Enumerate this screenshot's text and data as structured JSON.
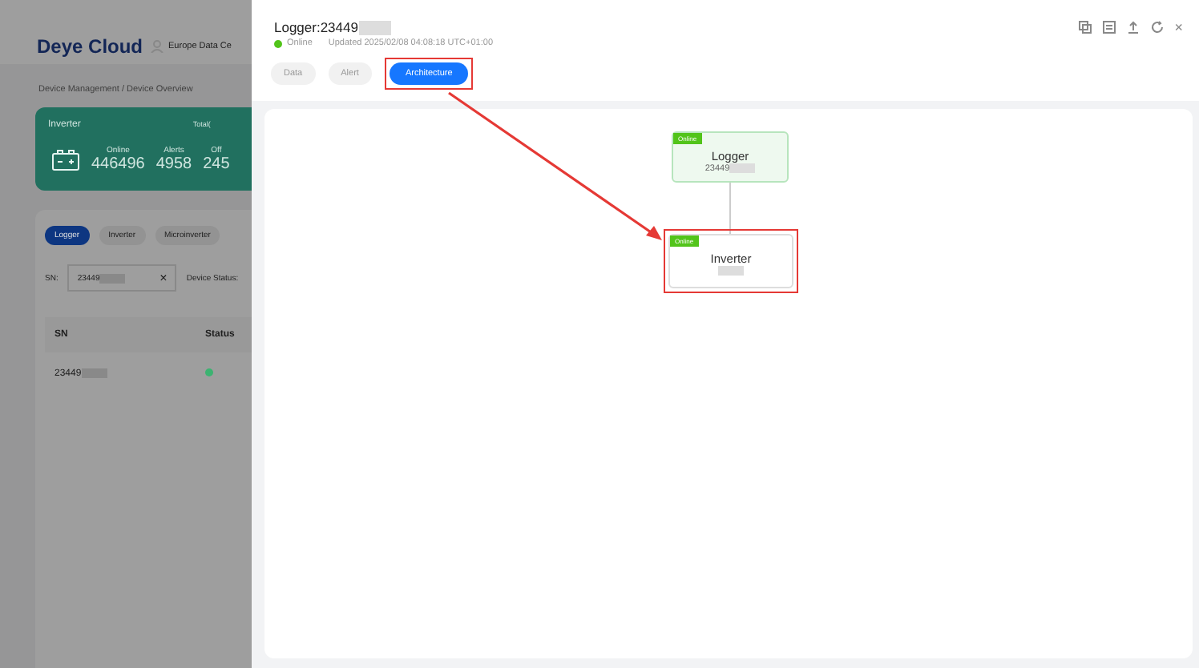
{
  "background_page": {
    "logo": "Deye Cloud",
    "region": "Europe Data Ce",
    "breadcrumb": "Device Management / Device Overview",
    "summary_card": {
      "title": "Inverter",
      "total": "Total(",
      "stats": [
        {
          "label": "Online",
          "value": "446496"
        },
        {
          "label": "Alerts",
          "value": "4958"
        },
        {
          "label": "Off",
          "value": "245"
        }
      ]
    },
    "tabs": [
      {
        "label": "Logger",
        "selected": true
      },
      {
        "label": "Inverter",
        "selected": false
      },
      {
        "label": "Microinverter",
        "selected": false
      }
    ],
    "filters": {
      "sn_label": "SN:",
      "sn_value": "23449",
      "clear": "×",
      "status_label": "Device Status:"
    },
    "table": {
      "columns": [
        "SN",
        "Status"
      ],
      "rows": [
        {
          "sn": "23449",
          "color": "#3cb371"
        }
      ]
    }
  },
  "drawer": {
    "title": "Logger:23449",
    "status": "Online",
    "updated": "Updated 2025/02/08 04:08:18 UTC+01:00",
    "close": "×",
    "tabs": [
      {
        "label": "Data",
        "selected": false
      },
      {
        "label": "Alert",
        "selected": false
      },
      {
        "label": "Architecture",
        "selected": true
      }
    ],
    "nodes": [
      {
        "badge": "Online",
        "name": "Logger",
        "sn": "23449",
        "highlighted": false
      },
      {
        "badge": "Online",
        "name": "Inverter",
        "highlighted": true
      }
    ]
  }
}
